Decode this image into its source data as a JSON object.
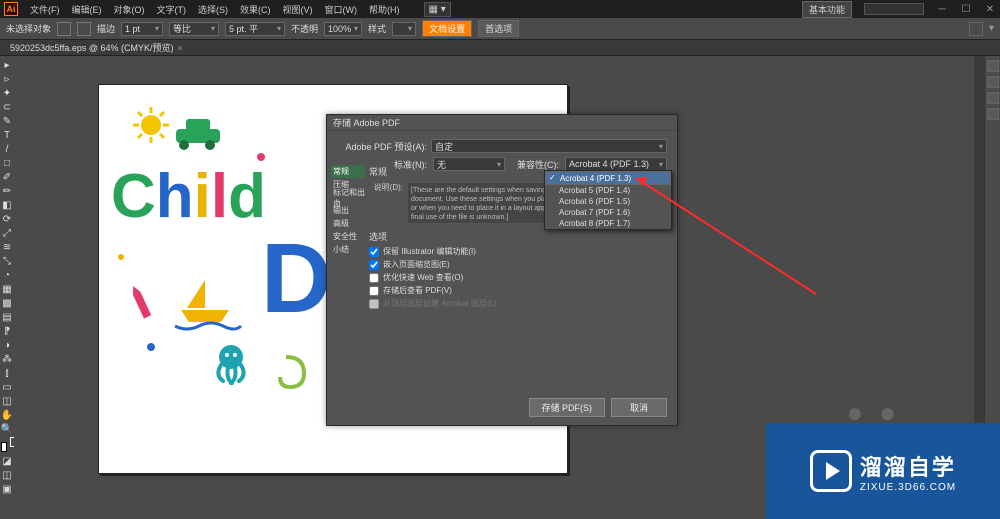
{
  "titlebar": {
    "workspace_label": "基本功能",
    "search_placeholder": ""
  },
  "menu": {
    "file": "文件(F)",
    "edit": "编辑(E)",
    "object": "对象(O)",
    "type": "文字(T)",
    "select": "选择(S)",
    "effect": "效果(C)",
    "view": "视图(V)",
    "window": "窗口(W)",
    "help": "帮助(H)"
  },
  "optbar": {
    "no_selection": "未选择对象",
    "stroke_label": "描边",
    "stroke_pt": "1 pt",
    "uniform": "等比",
    "opacity_label": "不透明",
    "style": "样式",
    "opacity_value": "100%",
    "doc_setup": "文档设置",
    "prefs": "首选项",
    "a": "5 pt. 平"
  },
  "doctab": {
    "name": "5920253dc5ffa.eps @ 64% (CMYK/预览)"
  },
  "dialog": {
    "title": "存储 Adobe PDF",
    "preset_label": "Adobe PDF 预设(A):",
    "preset_value": "自定",
    "standard_label": "标准(N):",
    "standard_value": "无",
    "compat_label": "兼容性(C):",
    "compat_value": "Acrobat 4 (PDF 1.3)",
    "tabs": [
      "常规",
      "压缩",
      "标记和出血",
      "输出",
      "高级",
      "安全性",
      "小结"
    ],
    "general_hdr": "常规",
    "desc_label": "说明(D):",
    "desc_text": "[These are the default settings when saving an Illustrator file as an Adobe PDF document. Use these settings when you plan on editing the file again in Illustrator, or when you need to place it in a layout application such as InDesign, or when the final use of the file is unknown.]",
    "options_hdr": "选项",
    "opt1": "保留 Illustrator 编辑功能(I)",
    "opt2": "嵌入页面缩览图(E)",
    "opt3": "优化快速 Web 查看(O)",
    "opt4": "存储后查看 PDF(V)",
    "opt5": "从顶层图层创建 Acrobat 图层(L)",
    "save_btn": "存储 PDF(S)",
    "cancel_btn": "取消"
  },
  "dropdown": {
    "items": [
      "Acrobat 4 (PDF 1.3)",
      "Acrobat 5 (PDF 1.4)",
      "Acrobat 6 (PDF 1.5)",
      "Acrobat 7 (PDF 1.6)",
      "Acrobat 8 (PDF 1.7)"
    ]
  },
  "brand": {
    "big": "溜溜自学",
    "small": "ZIXUE.3D66.COM"
  }
}
